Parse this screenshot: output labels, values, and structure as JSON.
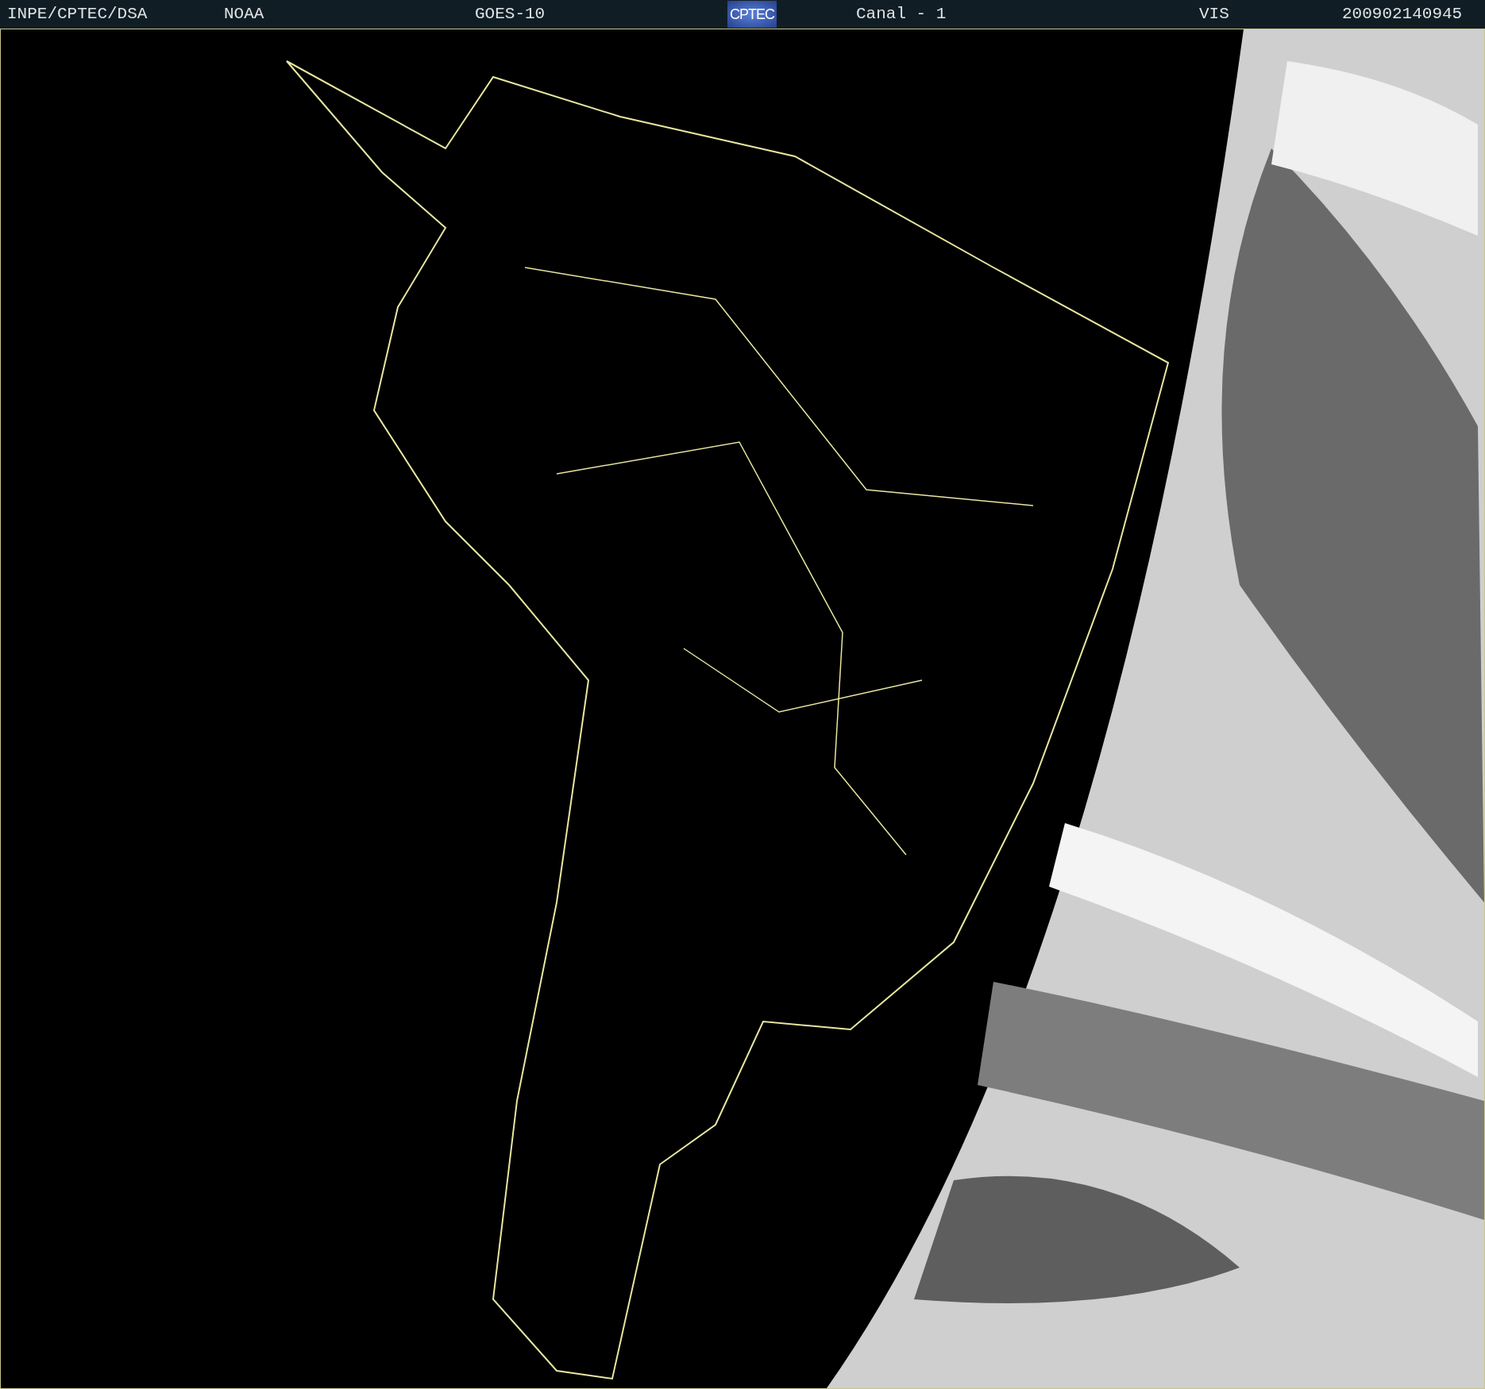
{
  "header": {
    "items": [
      {
        "kind": "text",
        "text": "INPE/CPTEC/DSA"
      },
      {
        "kind": "text",
        "text": "NOAA"
      },
      {
        "kind": "text",
        "text": "GOES-10"
      },
      {
        "kind": "logo",
        "text": "CPTEC"
      },
      {
        "kind": "text",
        "text": "Canal - 1"
      },
      {
        "kind": "text",
        "text": "VIS"
      },
      {
        "kind": "text",
        "text": "200902140945"
      }
    ]
  }
}
